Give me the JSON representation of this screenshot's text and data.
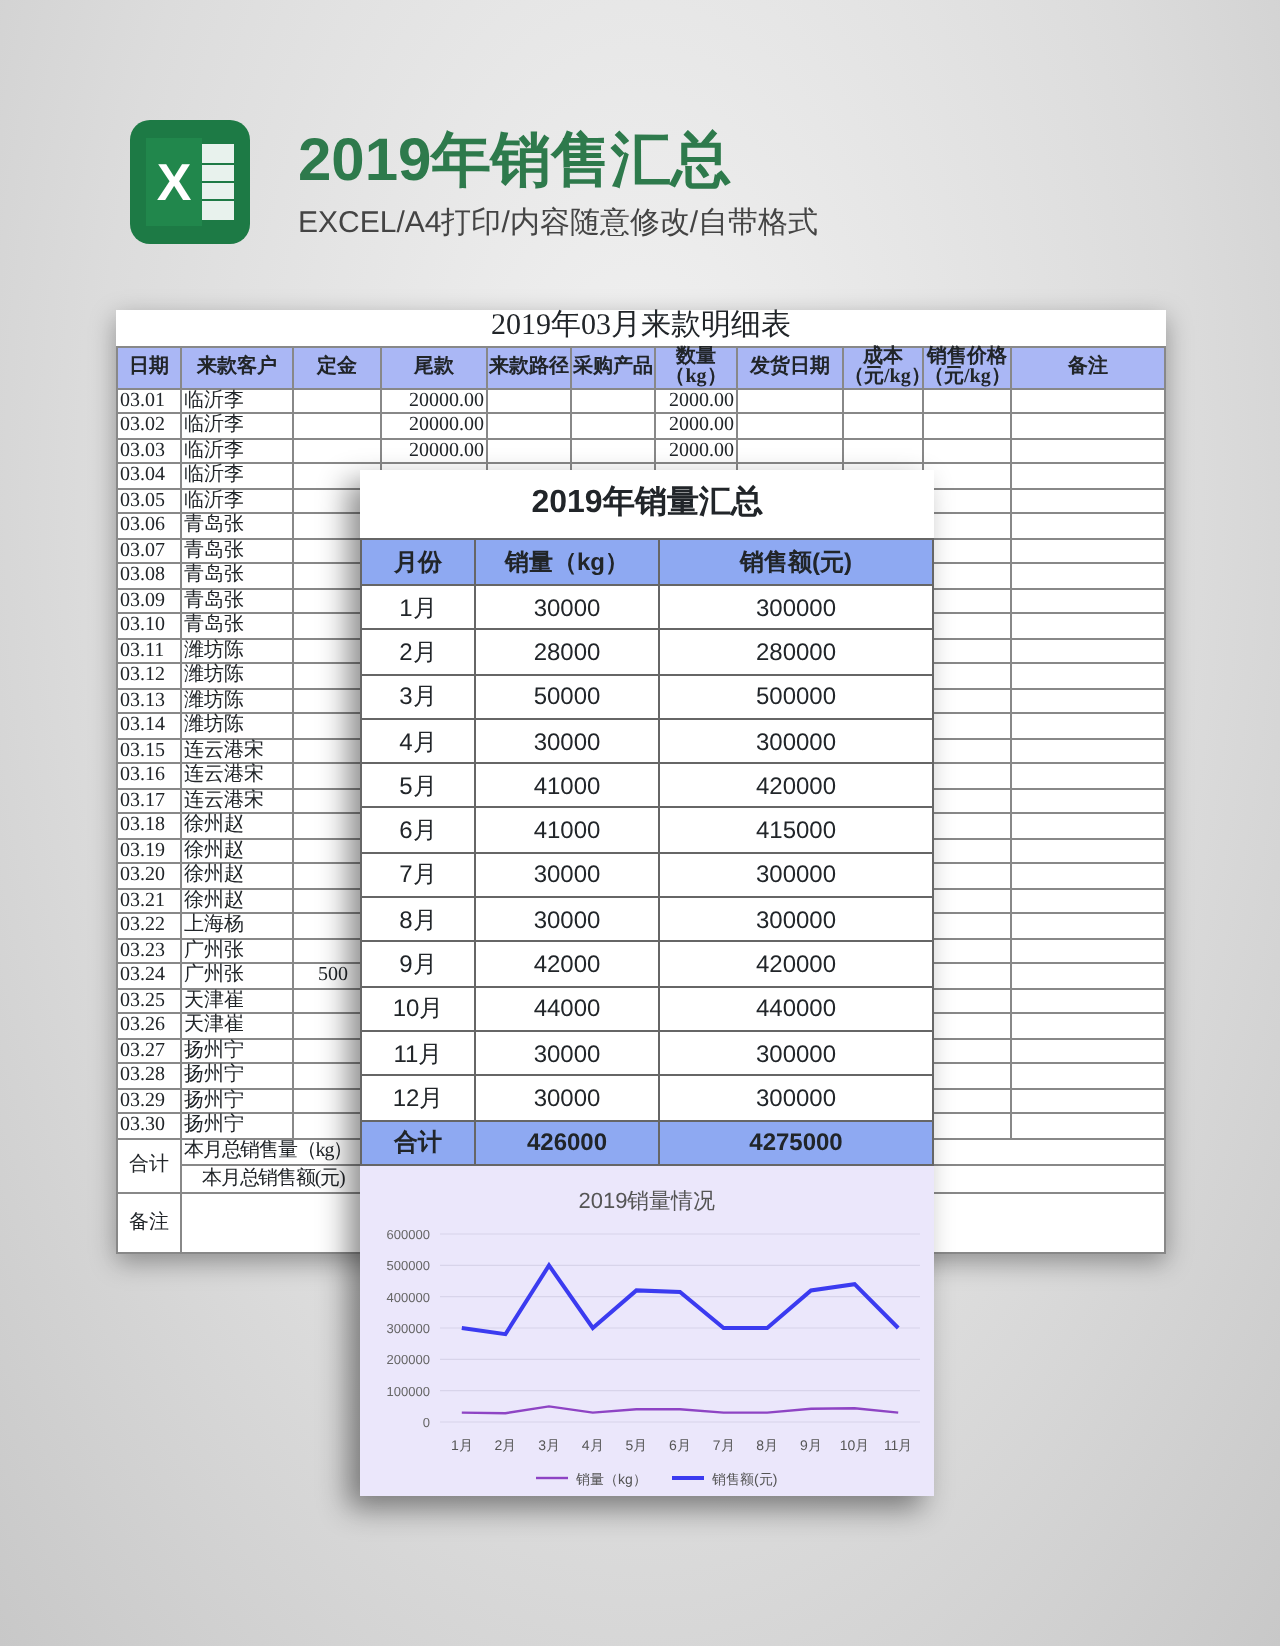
{
  "header": {
    "logo_letter": "X",
    "title": "2019年销售汇总",
    "subtitle": "EXCEL/A4打印/内容随意修改/自带格式"
  },
  "detail_sheet": {
    "title": "2019年03月来款明细表",
    "columns": [
      "日期",
      "来款客户",
      "定金",
      "尾款",
      "来款路径",
      "采购产品",
      "数量（kg）",
      "发货日期",
      "成本（元/kg）",
      "销售价格（元/kg）",
      "备注"
    ],
    "rows": [
      {
        "date": "03.01",
        "customer": "临沂李",
        "balance": "20000.00",
        "quantity": "2000.00"
      },
      {
        "date": "03.02",
        "customer": "临沂李",
        "balance": "20000.00",
        "quantity": "2000.00"
      },
      {
        "date": "03.03",
        "customer": "临沂李",
        "balance": "20000.00",
        "quantity": "2000.00"
      },
      {
        "date": "03.04",
        "customer": "临沂李"
      },
      {
        "date": "03.05",
        "customer": "临沂李"
      },
      {
        "date": "03.06",
        "customer": "青岛张"
      },
      {
        "date": "03.07",
        "customer": "青岛张"
      },
      {
        "date": "03.08",
        "customer": "青岛张"
      },
      {
        "date": "03.09",
        "customer": "青岛张"
      },
      {
        "date": "03.10",
        "customer": "青岛张"
      },
      {
        "date": "03.11",
        "customer": "潍坊陈"
      },
      {
        "date": "03.12",
        "customer": "潍坊陈"
      },
      {
        "date": "03.13",
        "customer": "潍坊陈"
      },
      {
        "date": "03.14",
        "customer": "潍坊陈"
      },
      {
        "date": "03.15",
        "customer": "连云港宋"
      },
      {
        "date": "03.16",
        "customer": "连云港宋"
      },
      {
        "date": "03.17",
        "customer": "连云港宋"
      },
      {
        "date": "03.18",
        "customer": "徐州赵"
      },
      {
        "date": "03.19",
        "customer": "徐州赵"
      },
      {
        "date": "03.20",
        "customer": "徐州赵"
      },
      {
        "date": "03.21",
        "customer": "徐州赵"
      },
      {
        "date": "03.22",
        "customer": "上海杨"
      },
      {
        "date": "03.23",
        "customer": "广州张"
      },
      {
        "date": "03.24",
        "customer": "广州张",
        "deposit": "500"
      },
      {
        "date": "03.25",
        "customer": "天津崔"
      },
      {
        "date": "03.26",
        "customer": "天津崔"
      },
      {
        "date": "03.27",
        "customer": "扬州宁"
      },
      {
        "date": "03.28",
        "customer": "扬州宁"
      },
      {
        "date": "03.29",
        "customer": "扬州宁"
      },
      {
        "date": "03.30",
        "customer": "扬州宁"
      }
    ],
    "total_label": "合计",
    "total_lines": [
      "本月总销售量（kg）",
      "本月总销售额(元)"
    ],
    "notes_label": "备注"
  },
  "summary_sheet": {
    "title": "2019年销量汇总",
    "columns": [
      "月份",
      "销量（kg）",
      "销售额(元)"
    ],
    "rows": [
      [
        "1月",
        "30000",
        "300000"
      ],
      [
        "2月",
        "28000",
        "280000"
      ],
      [
        "3月",
        "50000",
        "500000"
      ],
      [
        "4月",
        "30000",
        "300000"
      ],
      [
        "5月",
        "41000",
        "420000"
      ],
      [
        "6月",
        "41000",
        "415000"
      ],
      [
        "7月",
        "30000",
        "300000"
      ],
      [
        "8月",
        "30000",
        "300000"
      ],
      [
        "9月",
        "42000",
        "420000"
      ],
      [
        "10月",
        "44000",
        "440000"
      ],
      [
        "11月",
        "30000",
        "300000"
      ],
      [
        "12月",
        "30000",
        "300000"
      ]
    ],
    "total": [
      "合计",
      "426000",
      "4275000"
    ],
    "chart_data": {
      "type": "line",
      "title": "2019销量情况",
      "categories": [
        "1月",
        "2月",
        "3月",
        "4月",
        "5月",
        "6月",
        "7月",
        "8月",
        "9月",
        "10月",
        "11月"
      ],
      "series": [
        {
          "name": "销量（kg）",
          "color": "#8e44c4",
          "values": [
            30000,
            28000,
            50000,
            30000,
            41000,
            41000,
            30000,
            30000,
            42000,
            44000,
            30000
          ]
        },
        {
          "name": "销售额(元)",
          "color": "#3b3bf0",
          "values": [
            300000,
            280000,
            500000,
            300000,
            420000,
            415000,
            300000,
            300000,
            420000,
            440000,
            300000
          ]
        }
      ],
      "grid": true,
      "legend": true,
      "ylim": [
        0,
        600000
      ],
      "yticks": [
        0,
        100000,
        200000,
        300000,
        400000,
        500000,
        600000
      ]
    }
  }
}
